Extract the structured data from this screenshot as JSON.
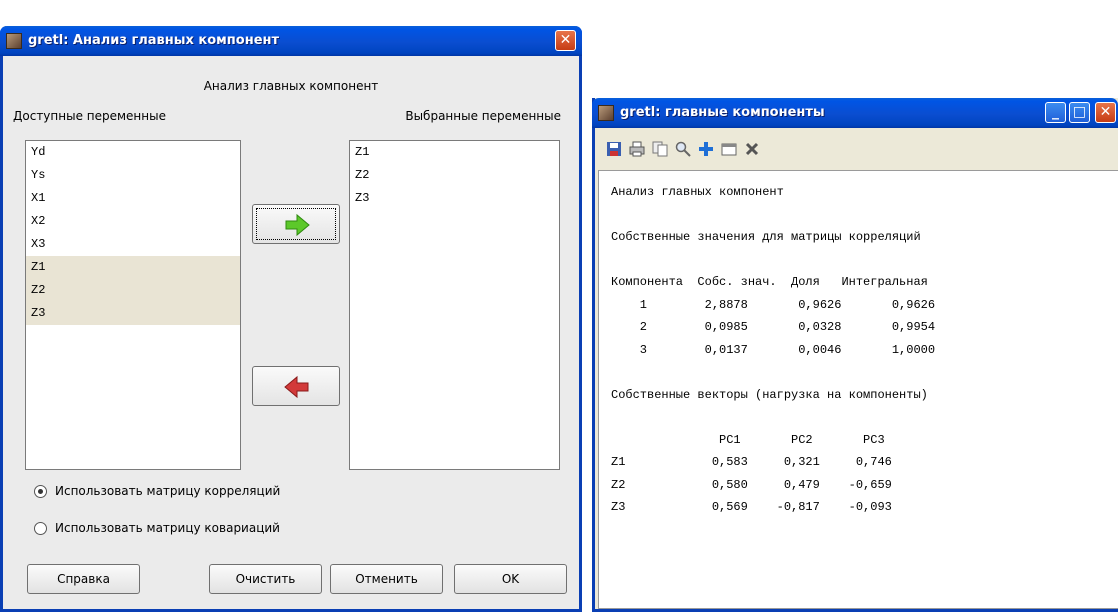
{
  "dialog": {
    "title": "gretl: Анализ главных компонент",
    "heading": "Анализ главных компонент",
    "available_label": "Доступные переменные",
    "selected_label": "Выбранные переменные",
    "available": [
      "Yd",
      "Ys",
      "X1",
      "X2",
      "X3",
      "Z1",
      "Z2",
      "Z3"
    ],
    "available_highlighted": [
      "Z1",
      "Z2",
      "Z3"
    ],
    "selected": [
      "Z1",
      "Z2",
      "Z3"
    ],
    "radio_corr": "Использовать матрицу корреляций",
    "radio_cov": "Использовать матрицу ковариаций",
    "radio_selected": "corr",
    "buttons": {
      "help": "Справка",
      "clear": "Очистить",
      "cancel": "Отменить",
      "ok": "OK"
    }
  },
  "output": {
    "title": "gretl: главные компоненты",
    "toolbar_icons": [
      "save-icon",
      "print-icon",
      "copy-icon",
      "find-icon",
      "add-icon",
      "window-icon",
      "close-icon"
    ],
    "lines": [
      "Анализ главных компонент",
      "",
      "Собственные значения для матрицы корреляций",
      "",
      "Компонента  Собс. знач.  Доля   Интегральная",
      "    1        2,8878       0,9626       0,9626",
      "    2        0,0985       0,0328       0,9954",
      "    3        0,0137       0,0046       1,0000",
      "",
      "Собственные векторы (нагрузка на компоненты)",
      "",
      "               PC1       PC2       PC3",
      "Z1            0,583     0,321     0,746",
      "Z2            0,580     0,479    -0,659",
      "Z3            0,569    -0,817    -0,093"
    ]
  },
  "colors": {
    "titlebar": "#0a4dd0",
    "close_button": "#c63c14",
    "arrow_add": "#5cc82a",
    "arrow_remove": "#c82a2a"
  }
}
